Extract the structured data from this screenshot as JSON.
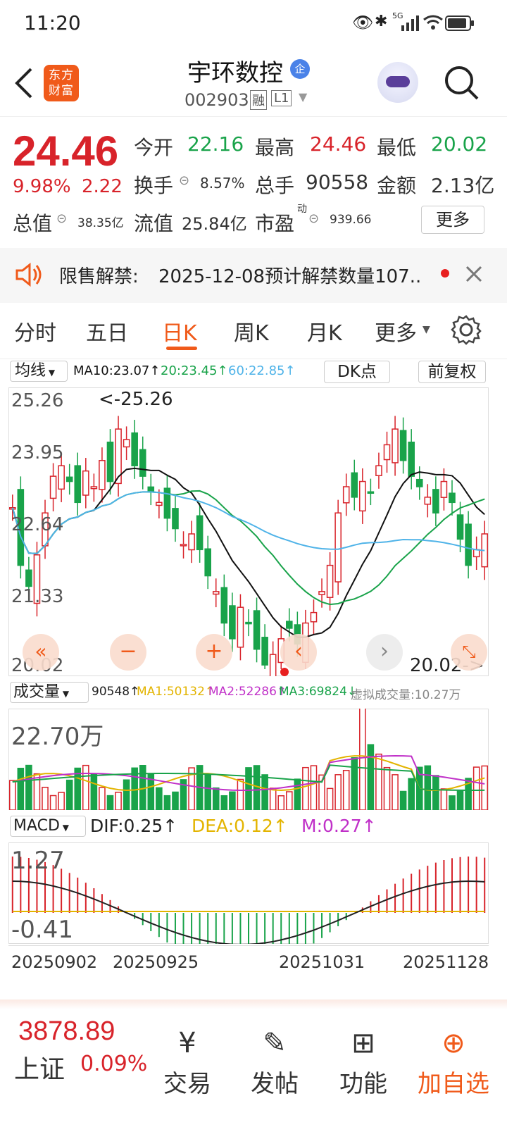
{
  "status": {
    "time": "11:20",
    "signal": "5G"
  },
  "header": {
    "title": "宇环数控",
    "badge": "企",
    "code": "002903",
    "tag_margin": "融",
    "tag_level": "L1",
    "logo_text": "东方财富"
  },
  "quote": {
    "price": "24.46",
    "change_pct": "9.98%",
    "change_amt": "2.22",
    "open_label": "今开",
    "open": "22.16",
    "high_label": "最高",
    "high": "24.46",
    "low_label": "最低",
    "low": "20.02",
    "turnover_label": "换手",
    "turnover": "8.57%",
    "volume_label": "总手",
    "volume": "90558",
    "amount_label": "金额",
    "amount": "2.13亿",
    "mktcap_label": "总值",
    "mktcap": "38.35亿",
    "float_label": "流值",
    "float_cap": "25.84亿",
    "pe_label": "市盈",
    "pe_sup": "动",
    "pe": "939.66",
    "more_button": "更多"
  },
  "notice": {
    "label": "限售解禁:",
    "text": "2025-12-08预计解禁数量107.."
  },
  "tabs": [
    "分时",
    "五日",
    "日K",
    "周K",
    "月K",
    "更多"
  ],
  "active_tab": 2,
  "kline": {
    "ma_select": "均线",
    "ma10": "MA10:23.07↑",
    "ma20": "20:23.45↑",
    "ma60": "60:22.85↑",
    "dk_button": "DK点",
    "fuquan_button": "前复权",
    "y_ticks": [
      "25.26",
      "23.95",
      "22.64",
      "21.33",
      "20.02"
    ],
    "max_label": "<-25.26",
    "min_label": "20.02->",
    "volume": {
      "select": "成交量",
      "value": "90548↑",
      "ma1": "MA1:50132↑",
      "ma2": "MA2:52286↑",
      "ma3": "MA3:69824↓",
      "virtual": "虚拟成交量:10.27万",
      "max_label": "22.70万"
    },
    "macd": {
      "select": "MACD",
      "dif": "DIF:0.25↑",
      "dea": "DEA:0.12↑",
      "m": "M:0.27↑",
      "top": "1.27",
      "bottom": "-0.41"
    },
    "dates": [
      "20250902",
      "20250925",
      "20251031",
      "20251128"
    ]
  },
  "bottom": {
    "index_value": "3878.89",
    "index_name": "上证",
    "index_pct": "0.09%",
    "nav": [
      "交易",
      "发帖",
      "功能",
      "加自选"
    ]
  },
  "colors": {
    "up": "#d8232a",
    "down": "#19a34a",
    "ma10": "#111111",
    "ma20": "#19a34a",
    "ma60": "#4fb3e8",
    "accent": "#f05a1a"
  }
}
